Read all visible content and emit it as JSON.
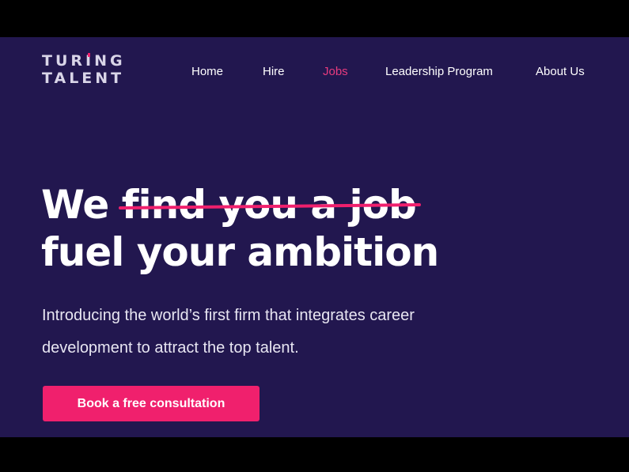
{
  "logo": {
    "line1_pre": "TUR",
    "line1_i": "I",
    "line1_post": "NG",
    "line2": "TALENT"
  },
  "nav": {
    "items": [
      {
        "label": "Home",
        "active": false
      },
      {
        "label": "Hire",
        "active": false
      },
      {
        "label": "Jobs",
        "active": true
      },
      {
        "label": "Leadership Program",
        "active": false
      },
      {
        "label": "About Us",
        "active": false
      }
    ]
  },
  "hero": {
    "headline_prefix": "We",
    "headline_struck": "find you a job",
    "headline_line2": "fuel your ambition",
    "subtitle_line1": "Introducing the world’s first firm that integrates career",
    "subtitle_line2": "development to attract the top talent.",
    "cta_label": "Book a free consultation"
  },
  "colors": {
    "background": "#22174f",
    "accent": "#f0206d",
    "active_nav": "#e83b7e",
    "text": "#ffffff"
  }
}
